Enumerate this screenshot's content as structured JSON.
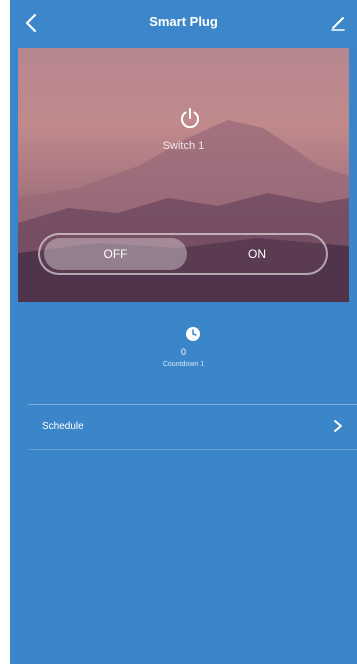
{
  "header": {
    "title": "Smart Plug",
    "back_icon": "chevron-left-icon",
    "edit_icon": "pencil-icon"
  },
  "hero": {
    "power_icon": "power-icon",
    "switch_name": "Switch 1",
    "toggle": {
      "off_label": "OFF",
      "on_label": "ON",
      "selected": "OFF"
    }
  },
  "countdown": {
    "icon": "timer-icon",
    "value": "0",
    "label": "Countdown 1"
  },
  "schedule": {
    "label": "Schedule",
    "chevron_icon": "chevron-right-icon"
  },
  "colors": {
    "background": "#3a86c8",
    "text": "#ffffff"
  }
}
